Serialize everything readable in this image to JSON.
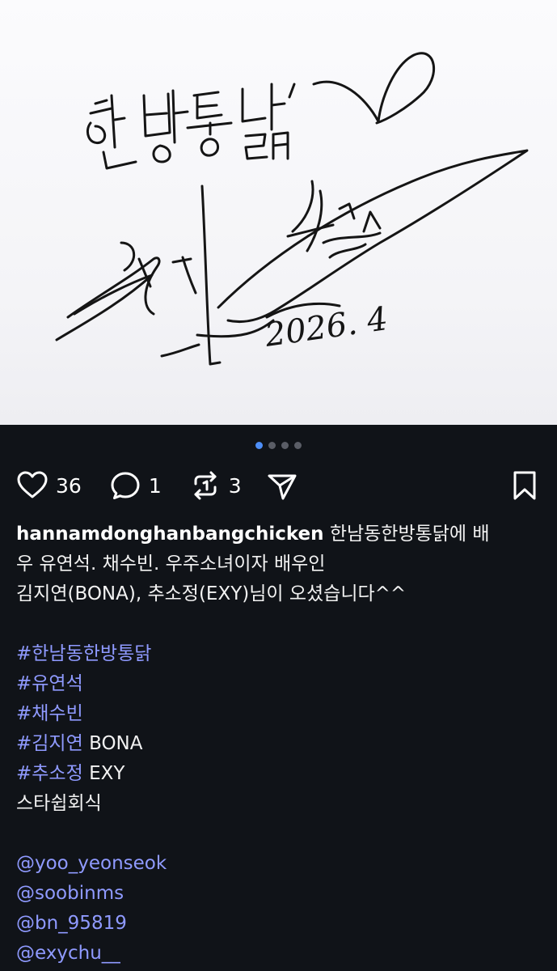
{
  "post": {
    "image": {
      "signature_text": "한방통닭",
      "date": "2026. 4"
    },
    "carousel": {
      "count": 4,
      "active_index": 0
    },
    "actions": {
      "likes": "36",
      "comments": "1",
      "reposts": "3"
    },
    "caption": {
      "username": "hannamdonghanbangchicken",
      "line1_text": "한남동한방통닭에 배",
      "line2": "우 유연석. 채수빈. 우주소녀이자 배우인",
      "line3": "김지연(BONA), 추소정(EXY)님이 오셨습니다^^",
      "hashtags": [
        {
          "tag": "#한남동한방통닭",
          "suffix": ""
        },
        {
          "tag": "#유연석",
          "suffix": ""
        },
        {
          "tag": "#채수빈",
          "suffix": ""
        },
        {
          "tag": "#김지연",
          "suffix": "BONA"
        },
        {
          "tag": "#추소정",
          "suffix": "EXY"
        }
      ],
      "plain_line": "스타쉽회식",
      "mentions": [
        "@yoo_yeonseok",
        "@soobinms",
        "@bn_95819",
        "@exychu__"
      ]
    }
  }
}
